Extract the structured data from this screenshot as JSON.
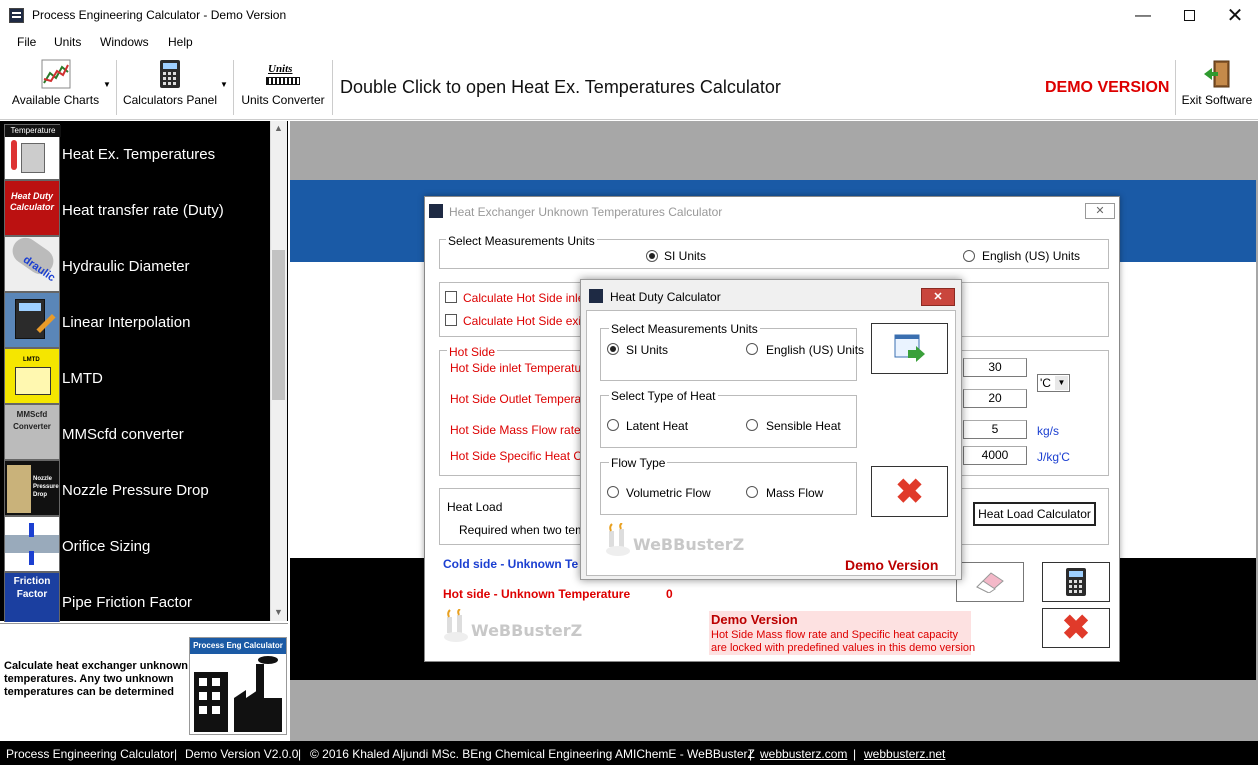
{
  "window": {
    "title": "Process Engineering Calculator - Demo Version"
  },
  "menu": [
    "File",
    "Units",
    "Windows",
    "Help"
  ],
  "toolbar": {
    "available_charts": "Available Charts",
    "calculators_panel": "Calculators Panel",
    "units_converter": "Units Converter",
    "units_icon_text": "Units",
    "hint": "Double Click to open Heat Ex. Temperatures Calculator",
    "demo": "DEMO VERSION",
    "exit": "Exit Software"
  },
  "sidebar": {
    "items": [
      {
        "label": "Heat Ex. Temperatures",
        "thumb": "Temperature"
      },
      {
        "label": "Heat transfer rate (Duty)",
        "thumb": "Heat Duty Calculator"
      },
      {
        "label": "Hydraulic Diameter",
        "thumb": "draulic"
      },
      {
        "label": "Linear Interpolation",
        "thumb": ""
      },
      {
        "label": "LMTD",
        "thumb": "LMTD"
      },
      {
        "label": "MMScfd converter",
        "thumb": "MMScfd Converter"
      },
      {
        "label": "Nozzle Pressure Drop",
        "thumb": "Nozzle Pressure Drop"
      },
      {
        "label": "Orifice Sizing",
        "thumb": ""
      },
      {
        "label": "Pipe Friction Factor",
        "thumb": "Friction Factor"
      }
    ],
    "description": "Calculate heat exchanger unknown temperatures. Any two unknown temperatures can be determined",
    "logo_text": "Process Eng Calculator"
  },
  "dialog_main": {
    "title": "Heat Exchanger Unknown Temperatures Calculator",
    "units_legend": "Select Measurements Units",
    "si": "SI Units",
    "english": "English (US) Units",
    "calc_inlet": "Calculate Hot Side inlet T",
    "calc_exit": "Calculate Hot Side exit T",
    "hot_side_legend": "Hot Side",
    "hot_inlet": "Hot Side inlet Temperature",
    "hot_outlet": "Hot Side Outlet Temperature",
    "mass_flow": "Hot Side Mass Flow rate",
    "specific_heat": "Hot Side Specific Heat Capa",
    "v_inlet": "30",
    "v_outlet": "20",
    "v_flow": "5",
    "v_cp": "4000",
    "temp_unit": "'C",
    "flow_unit": "kg/s",
    "cp_unit": "J/kg'C",
    "heat_load_legend": "Heat Load",
    "required": "Required when two tempe",
    "heat_load_btn": "Heat Load Calculator",
    "cold_unknown": "Cold side - Unknown Te",
    "hot_unknown": "Hot side - Unknown Temperature",
    "hot_unknown_value": "0",
    "demo_title": "Demo Version",
    "demo_line1": "Hot Side Mass flow rate and Specific heat capacity",
    "demo_line2": "are locked with predefined values in this demo version",
    "logo": "WeBBusterZ"
  },
  "dialog_duty": {
    "title": "Heat Duty Calculator",
    "units_legend": "Select Measurements Units",
    "si": "SI Units",
    "english": "English (US) Units",
    "heat_type_legend": "Select Type of Heat",
    "latent": "Latent Heat",
    "sensible": "Sensible Heat",
    "flow_legend": "Flow Type",
    "volumetric": "Volumetric Flow",
    "mass": "Mass Flow",
    "demo": "Demo Version",
    "logo": "WeBBusterZ"
  },
  "status": {
    "part1": "Process Engineering Calculator",
    "part2": "Demo Version V2.0.0",
    "part3": "© 2016 Khaled Aljundi MSc. BEng Chemical Engineering AMIChemE - WeBBusterZ",
    "link1": "webbusterz.com",
    "link2": "webbusterz.net"
  }
}
